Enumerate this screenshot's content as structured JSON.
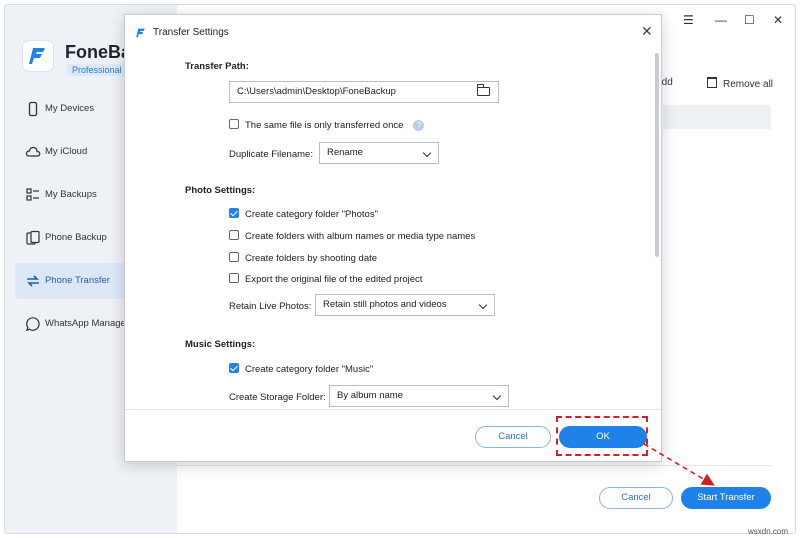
{
  "app": {
    "name": "FoneBa",
    "edition": "Professional"
  },
  "sidebar": {
    "items": [
      {
        "label": "My Devices",
        "icon": "phone-icon",
        "active": false
      },
      {
        "label": "My iCloud",
        "icon": "cloud-icon",
        "active": false
      },
      {
        "label": "My Backups",
        "icon": "backups-icon",
        "active": false
      },
      {
        "label": "Phone Backup",
        "icon": "phone-backup-icon",
        "active": false
      },
      {
        "label": "Phone Transfer",
        "icon": "transfer-icon",
        "active": true
      },
      {
        "label": "WhatsApp Manager",
        "icon": "whatsapp-icon",
        "active": false
      }
    ]
  },
  "window_controls": {
    "menu": "☰",
    "minimize": "—",
    "maximize": "☐",
    "close": "✕"
  },
  "toolbar": {
    "add_label": "Add",
    "remove_all_label": "Remove all"
  },
  "bottom": {
    "cancel_label": "Cancel",
    "start_label": "Start Transfer"
  },
  "dialog": {
    "title": "Transfer Settings",
    "close_glyph": "✕",
    "transfer_path": {
      "heading": "Transfer Path:",
      "path_value": "C:\\Users\\admin\\Desktop\\FoneBackup",
      "same_file_label": "The same file is only transferred once",
      "same_file_checked": false,
      "help_glyph": "?",
      "duplicate_label": "Duplicate Filename:",
      "duplicate_value": "Rename"
    },
    "photo": {
      "heading": "Photo Settings:",
      "options": [
        {
          "label": "Create category folder \"Photos\"",
          "checked": true
        },
        {
          "label": "Create folders with album names or media type names",
          "checked": false
        },
        {
          "label": "Create folders by shooting date",
          "checked": false
        },
        {
          "label": "Export the original file of the edited project",
          "checked": false
        }
      ],
      "live_label": "Retain Live Photos:",
      "live_value": "Retain still photos and videos"
    },
    "music": {
      "heading": "Music Settings:",
      "category_label": "Create category folder \"Music\"",
      "category_checked": true,
      "storage_label": "Create Storage Folder:",
      "storage_value": "By album name"
    },
    "cancel_label": "Cancel",
    "ok_label": "OK"
  },
  "colors": {
    "accent": "#1e82e8",
    "annotation": "#d32026"
  },
  "watermark": "wsxdn.com"
}
